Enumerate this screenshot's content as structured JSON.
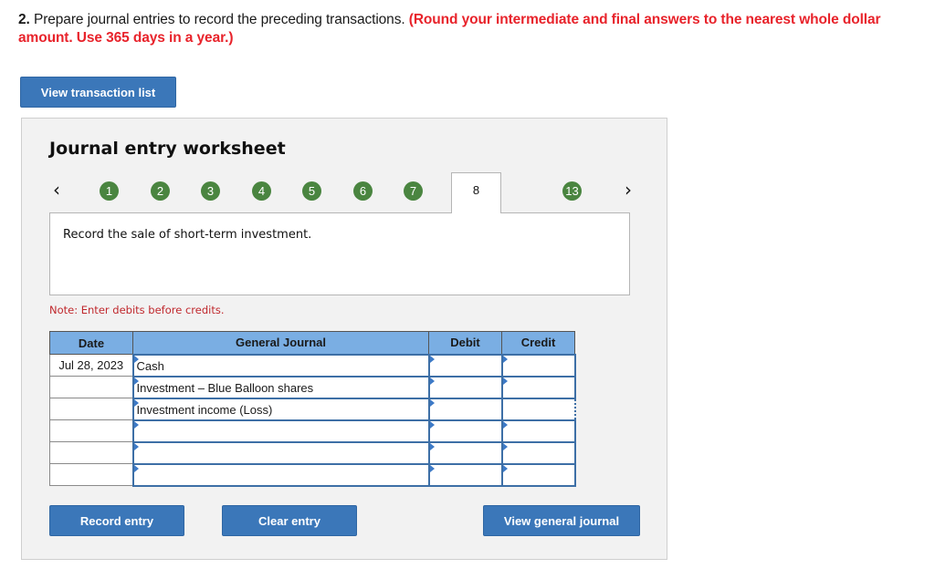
{
  "question": {
    "number": "2.",
    "text": "Prepare journal entries to record the preceding transactions.",
    "instruction": "(Round your intermediate and final answers to the nearest whole dollar amount. Use 365 days in a year.)"
  },
  "view_transaction_list_label": "View transaction list",
  "worksheet": {
    "title": "Journal entry worksheet",
    "nav": {
      "prev_icon": "‹",
      "next_icon": "›"
    },
    "steps": [
      "1",
      "2",
      "3",
      "4",
      "5",
      "6",
      "7",
      "8",
      "13"
    ],
    "active_step": "8",
    "description": "Record the sale of short-term investment.",
    "note": "Note: Enter debits before credits.",
    "table": {
      "headers": {
        "date": "Date",
        "general_journal": "General Journal",
        "debit": "Debit",
        "credit": "Credit"
      },
      "rows": [
        {
          "date": "Jul 28, 2023",
          "account": "Cash",
          "debit": "",
          "credit": ""
        },
        {
          "date": "",
          "account": "Investment – Blue Balloon shares",
          "debit": "",
          "credit": ""
        },
        {
          "date": "",
          "account": "Investment income (Loss)",
          "debit": "",
          "credit": ""
        },
        {
          "date": "",
          "account": "",
          "debit": "",
          "credit": ""
        },
        {
          "date": "",
          "account": "",
          "debit": "",
          "credit": ""
        },
        {
          "date": "",
          "account": "",
          "debit": "",
          "credit": ""
        }
      ]
    },
    "buttons": {
      "record": "Record entry",
      "clear": "Clear entry",
      "view_general_journal": "View general journal"
    }
  },
  "colors": {
    "button_blue": "#3b77b9",
    "step_green": "#4a8540",
    "header_blue": "#7aaee3",
    "instruction_red": "#e8232b",
    "note_red": "#c0282d"
  }
}
